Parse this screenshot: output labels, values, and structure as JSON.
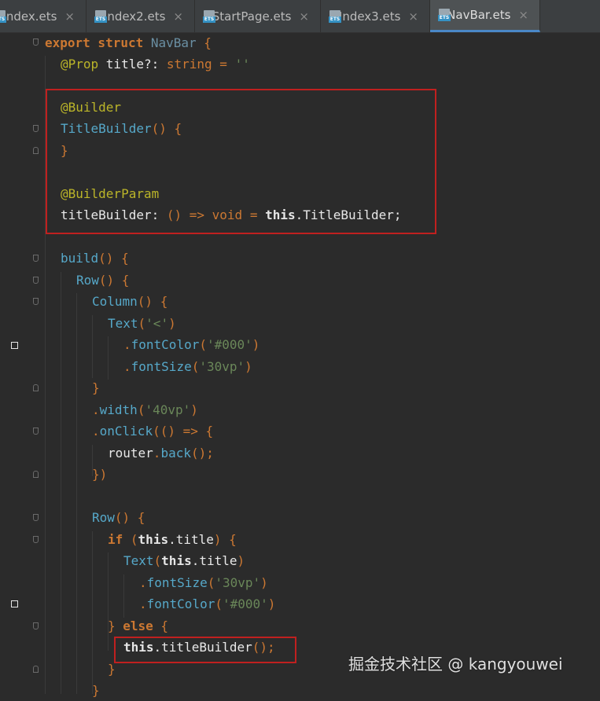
{
  "tabs": [
    {
      "label": "Index.ets",
      "icon": "ets-file-icon",
      "active": false
    },
    {
      "label": "Index2.ets",
      "icon": "ets-file-icon",
      "active": false
    },
    {
      "label": "StartPage.ets",
      "icon": "ets-file-icon",
      "active": false
    },
    {
      "label": "Index3.ets",
      "icon": "ets-file-icon",
      "active": false
    },
    {
      "label": "NavBar.ets",
      "icon": "ets-file-icon",
      "active": true
    }
  ],
  "close_glyph": "×",
  "ets_label": "ETS",
  "code": {
    "l1": {
      "a": "export struct ",
      "b": "NavBar",
      "c": " {"
    },
    "l2": {
      "a": "@Prop ",
      "b": "title?: ",
      "c": "string",
      "d": " = ",
      "e": "''"
    },
    "l3": {
      "a": "@Builder"
    },
    "l4": {
      "a": "TitleBuilder",
      "b": "() {"
    },
    "l5": {
      "a": "}"
    },
    "l6": {
      "a": "@BuilderParam"
    },
    "l7": {
      "a": "titleBuilder: ",
      "b": "() => ",
      "c": "void",
      "d": " = ",
      "e": "this",
      "f": ".TitleBuilder;"
    },
    "l8": {
      "a": "build",
      "b": "() {"
    },
    "l9": {
      "a": "Row",
      "b": "() {"
    },
    "l10": {
      "a": "Column",
      "b": "() {"
    },
    "l11": {
      "a": "Text",
      "b": "(",
      "c": "'<'",
      "d": ")"
    },
    "l12": {
      "a": ".",
      "b": "fontColor",
      "c": "(",
      "d": "'#000'",
      "e": ")"
    },
    "l13": {
      "a": ".",
      "b": "fontSize",
      "c": "(",
      "d": "'30vp'",
      "e": ")"
    },
    "l14": {
      "a": "}"
    },
    "l15": {
      "a": ".",
      "b": "width",
      "c": "(",
      "d": "'40vp'",
      "e": ")"
    },
    "l16": {
      "a": ".",
      "b": "onClick",
      "c": "(() => {"
    },
    "l17": {
      "a": "router",
      "b": ".",
      "c": "back",
      "d": "();"
    },
    "l18": {
      "a": "})"
    },
    "l19": {
      "a": "Row",
      "b": "() {"
    },
    "l20": {
      "a": "if ",
      "b": "(",
      "c": "this",
      "d": ".title",
      "e": ") {"
    },
    "l21": {
      "a": "Text",
      "b": "(",
      "c": "this",
      "d": ".title",
      "e": ")"
    },
    "l22": {
      "a": ".",
      "b": "fontSize",
      "c": "(",
      "d": "'30vp'",
      "e": ")"
    },
    "l23": {
      "a": ".",
      "b": "fontColor",
      "c": "(",
      "d": "'#000'",
      "e": ")"
    },
    "l24": {
      "a": "} ",
      "b": "else",
      "c": " {"
    },
    "l25": {
      "a": "this",
      "b": ".titleBuilder",
      "c": "();"
    },
    "l26": {
      "a": "}"
    },
    "l27": {
      "a": "}"
    }
  },
  "watermark": "掘金技术社区 @ kangyouwei",
  "colors": {
    "highlight": "#c0201f",
    "background": "#2b2b2b",
    "keyword": "#cc7832",
    "string": "#6a8759",
    "decorator": "#bbb529",
    "function": "#56a8c9"
  }
}
